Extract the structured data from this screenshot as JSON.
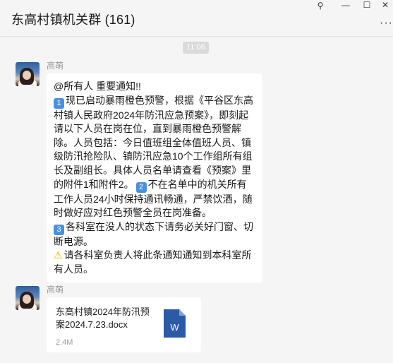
{
  "window": {
    "title": "东高村镇机关群 (161)",
    "controls": {
      "pin": "⚲",
      "minimize": "—",
      "maximize": "☐",
      "close": "✕"
    },
    "more": "···"
  },
  "timestamp": "11:06",
  "messages": [
    {
      "sender": "高萌",
      "type": "text",
      "line1": "@所有人 重要通知!!",
      "p1_badge": "1",
      "p1": "现已启动暴雨橙色预警，根据《平谷区东高村镇人民政府2024年防汛应急预案》，即刻起请以下人员在岗在位，直到暴雨橙色预警解除。人员包括：今日值班组全体值班人员、镇级防汛抢险队、镇防汛应急10个工作组所有组长及副组长。具体人员名单请查看《预案》里的附件1和附件2。",
      "p2_badge": "2",
      "p2": "不在名单中的机关所有工作人员24小时保持通讯畅通，严禁饮酒，随时做好应对红色预警全员在岗准备。",
      "p3_badge": "3",
      "p3": "各科室在没人的状态下请务必关好门窗、切断电源。",
      "p4_icon": "⚠",
      "p4": "请各科室负责人将此条通知通知到本科室所有人员。"
    },
    {
      "sender": "高萌",
      "type": "file",
      "file_name": "东高村镇2024年防汛预案2024.7.23.docx",
      "file_size": "2.4M",
      "file_icon_letter": "W"
    }
  ],
  "colors": {
    "background": "#f5f5f5",
    "bubble": "#ffffff",
    "word_blue": "#2b5aa8",
    "badge_blue": "#4a8fe0",
    "warning": "#e8b100"
  }
}
